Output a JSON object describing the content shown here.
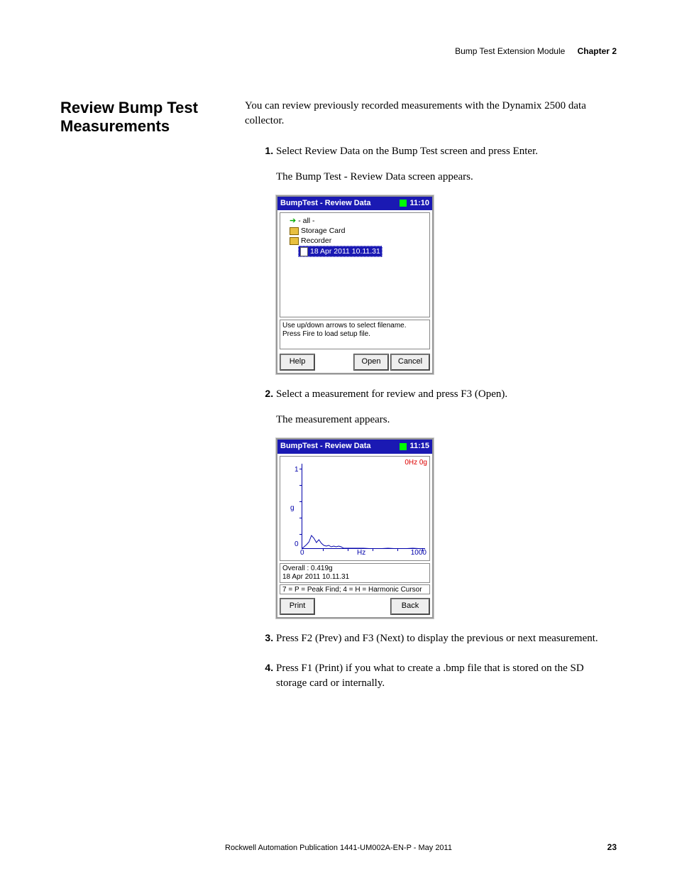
{
  "header": {
    "module": "Bump Test Extension Module",
    "chapter": "Chapter 2"
  },
  "section_title": "Review Bump Test Measurements",
  "intro": "You can review previously recorded measurements with the Dynamix 2500 data collector.",
  "steps": [
    {
      "text": "Select Review Data on the Bump Test screen and press Enter.",
      "after": "The Bump Test - Review Data screen appears."
    },
    {
      "text": "Select a measurement for review and press F3 (Open).",
      "after": "The measurement appears."
    },
    {
      "text": "Press F2 (Prev) and F3 (Next) to display the previous or next measurement."
    },
    {
      "text": "Press F1 (Print) if you what to create a .bmp file that is stored on the SD storage card or internally."
    }
  ],
  "device1": {
    "title": "BumpTest - Review Data",
    "time": "11:10",
    "tree": {
      "all": "- all -",
      "storage": "Storage Card",
      "recorder": "Recorder",
      "file": "18 Apr 2011 10.11.31"
    },
    "hint1": "Use up/down arrows to select filename.",
    "hint2": "Press Fire to load setup file.",
    "buttons": {
      "help": "Help",
      "open": "Open",
      "cancel": "Cancel"
    }
  },
  "device2": {
    "title": "BumpTest - Review Data",
    "time": "11:15",
    "cursor": "0Hz  0g",
    "y_ticks": [
      "1",
      "g",
      "0"
    ],
    "x_ticks": {
      "left": "0",
      "mid": "Hz",
      "right": "1000"
    },
    "overall": "Overall  : 0.419g",
    "timestamp": "18 Apr 2011 10.11.31",
    "hint": "7 = P = Peak Find; 4 = H = Harmonic Cursor",
    "buttons": {
      "print": "Print",
      "back": "Back"
    }
  },
  "chart_data": {
    "type": "line",
    "title": "BumpTest - Review Data",
    "xlabel": "Hz",
    "ylabel": "g",
    "xlim": [
      0,
      1000
    ],
    "ylim": [
      0,
      1
    ],
    "overall": 0.419,
    "timestamp": "18 Apr 2011 10.11.31",
    "cursor": {
      "x": 0,
      "y": 0
    },
    "x": [
      0,
      20,
      40,
      60,
      80,
      100,
      120,
      140,
      160,
      180,
      200,
      220,
      240,
      260,
      280,
      300,
      320,
      340,
      400,
      500,
      600,
      700,
      800,
      900,
      1000
    ],
    "y": [
      0.0,
      0.02,
      0.05,
      0.08,
      0.15,
      0.12,
      0.07,
      0.1,
      0.06,
      0.04,
      0.03,
      0.04,
      0.02,
      0.03,
      0.02,
      0.03,
      0.02,
      0.01,
      0.01,
      0.01,
      0.0,
      0.01,
      0.0,
      0.01,
      0.0
    ]
  },
  "footer": {
    "pub": "Rockwell Automation Publication 1441-UM002A-EN-P - May 2011",
    "page": "23"
  }
}
